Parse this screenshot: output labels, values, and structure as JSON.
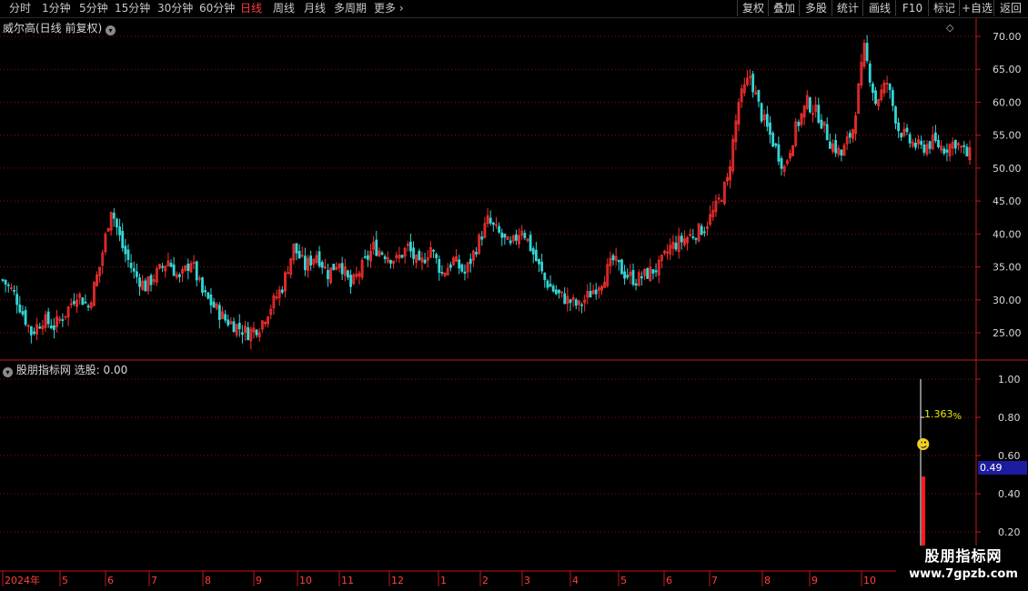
{
  "toolbar": {
    "periods": [
      "分时",
      "1分钟",
      "5分钟",
      "15分钟",
      "30分钟",
      "60分钟",
      "日线",
      "周线",
      "月线",
      "多周期",
      "更多"
    ],
    "active_period": "日线",
    "buttons": [
      "复权",
      "叠加",
      "多股",
      "统计",
      "画线",
      "F10",
      "标记",
      "+自选",
      "返回"
    ]
  },
  "main_panel": {
    "title": "威尔高(日线 前复权)",
    "price_axis": [
      "70.00",
      "65.00",
      "60.00",
      "55.00",
      "50.00",
      "45.00",
      "40.00",
      "35.00",
      "30.00",
      "25.00"
    ]
  },
  "indicator_panel": {
    "title": "股朋指标网",
    "value_label": "选股: 0.00",
    "axis": [
      "1.00",
      "0.80",
      "0.60",
      "0.40",
      "0.20"
    ],
    "current_value": "0.49",
    "annotation": "1.363",
    "annotation_unit": "%",
    "smiley": "☻"
  },
  "date_axis": [
    "2024年",
    "5",
    "6",
    "7",
    "8",
    "9",
    "10",
    "11",
    "12",
    "1",
    "2",
    "3",
    "4",
    "5",
    "6",
    "7",
    "8",
    "9",
    "10"
  ],
  "watermark": {
    "line1": "股朋指标网",
    "line2": "www.7gpzb.com"
  },
  "colors": {
    "up": "#ff3030",
    "down": "#34d6d6",
    "grid": "#8a1010",
    "axis_text": "#d8d8d8",
    "active": "#ff3b3b",
    "badge": "#1c1c9e"
  },
  "chart_data": {
    "type": "candlestick",
    "ylim": [
      22,
      71
    ],
    "description_points": [
      [
        0,
        33
      ],
      [
        4,
        31
      ],
      [
        8,
        27
      ],
      [
        10,
        25
      ],
      [
        14,
        27
      ],
      [
        18,
        26
      ],
      [
        22,
        28
      ],
      [
        26,
        31
      ],
      [
        30,
        29
      ],
      [
        34,
        35
      ],
      [
        38,
        44
      ],
      [
        42,
        38
      ],
      [
        46,
        34
      ],
      [
        50,
        32
      ],
      [
        54,
        34
      ],
      [
        58,
        36
      ],
      [
        62,
        33
      ],
      [
        66,
        36
      ],
      [
        70,
        31
      ],
      [
        74,
        29
      ],
      [
        78,
        27
      ],
      [
        82,
        26
      ],
      [
        86,
        25
      ],
      [
        90,
        26
      ],
      [
        94,
        29
      ],
      [
        98,
        32
      ],
      [
        102,
        38
      ],
      [
        106,
        35
      ],
      [
        110,
        37
      ],
      [
        114,
        34
      ],
      [
        118,
        36
      ],
      [
        122,
        32
      ],
      [
        126,
        35
      ],
      [
        130,
        38
      ],
      [
        134,
        37
      ],
      [
        138,
        36
      ],
      [
        142,
        38
      ],
      [
        146,
        35
      ],
      [
        150,
        38
      ],
      [
        154,
        34
      ],
      [
        158,
        36
      ],
      [
        162,
        34
      ],
      [
        166,
        38
      ],
      [
        170,
        42
      ],
      [
        174,
        40
      ],
      [
        178,
        38
      ],
      [
        182,
        41
      ],
      [
        186,
        37
      ],
      [
        190,
        33
      ],
      [
        194,
        31
      ],
      [
        198,
        30
      ],
      [
        202,
        29
      ],
      [
        206,
        31
      ],
      [
        210,
        33
      ],
      [
        214,
        36
      ],
      [
        218,
        34
      ],
      [
        222,
        33
      ],
      [
        226,
        34
      ],
      [
        230,
        35
      ],
      [
        234,
        38
      ],
      [
        238,
        39
      ],
      [
        242,
        40
      ],
      [
        246,
        41
      ],
      [
        250,
        44
      ],
      [
        254,
        48
      ],
      [
        258,
        60
      ],
      [
        262,
        64
      ],
      [
        266,
        58
      ],
      [
        270,
        54
      ],
      [
        274,
        50
      ],
      [
        278,
        56
      ],
      [
        282,
        60
      ],
      [
        286,
        58
      ],
      [
        290,
        54
      ],
      [
        294,
        52
      ],
      [
        298,
        56
      ],
      [
        302,
        68
      ],
      [
        306,
        60
      ],
      [
        310,
        63
      ],
      [
        314,
        56
      ],
      [
        318,
        54
      ],
      [
        322,
        53
      ],
      [
        326,
        54
      ],
      [
        330,
        53
      ],
      [
        334,
        54
      ],
      [
        338,
        52
      ]
    ]
  }
}
